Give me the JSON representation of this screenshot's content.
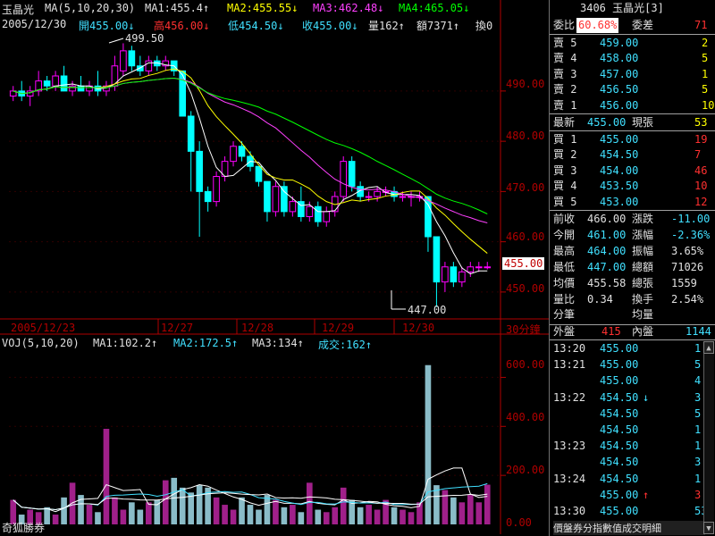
{
  "header": {
    "stock_name": "玉晶光",
    "ma_label": "MA(5,10,20,30)",
    "ma1": "MA1:455.4↑",
    "ma2": "MA2:455.55↓",
    "ma3": "MA3:462.48↓",
    "ma4": "MA4:465.05↓",
    "date": "2005/12/30",
    "open": "開455.00↓",
    "high": "高456.00↓",
    "low": "低454.50↓",
    "close": "收455.00↓",
    "volume": "量162↑",
    "amount": "額7371↑",
    "turnover": "換0"
  },
  "price_chart": {
    "y_ticks": [
      "490.00",
      "480.00",
      "470.00",
      "460.00",
      "450.00"
    ],
    "current_price_tag": "455.00",
    "max_label": "499.50",
    "min_label": "447.00",
    "x_labels": [
      "2005/12/23",
      "12/27",
      "12/28",
      "12/29",
      "12/30"
    ],
    "period": "30分鐘"
  },
  "volume_chart": {
    "label": "VOJ(5,10,20)",
    "ma1": "MA1:102.2↑",
    "ma2": "MA2:172.5↑",
    "ma3": "MA3:134↑",
    "deal": "成交:162↑",
    "y_ticks": [
      "600.00",
      "400.00",
      "200.00",
      "0.00"
    ],
    "brand": "奇狐勝券"
  },
  "colors": {
    "up": "#ff00ff",
    "down": "#00ffff",
    "ma1": "#ffffff",
    "ma2": "#ffff00",
    "ma3": "#ff40ff",
    "ma4": "#00ff00",
    "axis": "#b00000"
  },
  "chart_data": {
    "type": "candlestick",
    "x": "30-minute bars 2005/12/23 – 2005/12/30",
    "y_range": [
      445,
      501
    ],
    "bars": [
      [
        489,
        491,
        488,
        490
      ],
      [
        490,
        492,
        488,
        489
      ],
      [
        489,
        491,
        487,
        490
      ],
      [
        490,
        494,
        489,
        492
      ],
      [
        492,
        493,
        490,
        491
      ],
      [
        491,
        494,
        490,
        493
      ],
      [
        493,
        495,
        490,
        490
      ],
      [
        490,
        492,
        489,
        491
      ],
      [
        491,
        493,
        490,
        490
      ],
      [
        490,
        492,
        489,
        491
      ],
      [
        491,
        494,
        489,
        490
      ],
      [
        490,
        492,
        489,
        491
      ],
      [
        491,
        497,
        490,
        495
      ],
      [
        494,
        499.5,
        493,
        498
      ],
      [
        498,
        499,
        494,
        495
      ],
      [
        495,
        497,
        493,
        494
      ],
      [
        494,
        497,
        493,
        496
      ],
      [
        496,
        497,
        494,
        495
      ],
      [
        495,
        497,
        494,
        496
      ],
      [
        496,
        496,
        493,
        494
      ],
      [
        494,
        494,
        485,
        485
      ],
      [
        485,
        486,
        470,
        478
      ],
      [
        478,
        480,
        461,
        470
      ],
      [
        470,
        471,
        466,
        468
      ],
      [
        468,
        474,
        467,
        473
      ],
      [
        473,
        477,
        472,
        476
      ],
      [
        476,
        480,
        475,
        479
      ],
      [
        479,
        480,
        476,
        477
      ],
      [
        477,
        478,
        474,
        475
      ],
      [
        475,
        475,
        471,
        472
      ],
      [
        472,
        472,
        464,
        466
      ],
      [
        466,
        472,
        465,
        471
      ],
      [
        471,
        472,
        465,
        466
      ],
      [
        466,
        469,
        465,
        468
      ],
      [
        468,
        471,
        464,
        465
      ],
      [
        465,
        468,
        464,
        467
      ],
      [
        467,
        468,
        463,
        464
      ],
      [
        464,
        467,
        463,
        466
      ],
      [
        466,
        470,
        465,
        469
      ],
      [
        469,
        477,
        468,
        476
      ],
      [
        476,
        477,
        470,
        471
      ],
      [
        471,
        472,
        468,
        469
      ],
      [
        469,
        470,
        468,
        469
      ],
      [
        469,
        471,
        468,
        470
      ],
      [
        470,
        471,
        469,
        470
      ],
      [
        470,
        471,
        468,
        469
      ],
      [
        469,
        470,
        468,
        469
      ],
      [
        469,
        470,
        467,
        469
      ],
      [
        469,
        470,
        468,
        469
      ],
      [
        469,
        469,
        458,
        461
      ],
      [
        461,
        461,
        447,
        452
      ],
      [
        452,
        456,
        450,
        455
      ],
      [
        455,
        456,
        451,
        452
      ],
      [
        452,
        455,
        451,
        454
      ],
      [
        454,
        456,
        453,
        455
      ],
      [
        455,
        456,
        454,
        455
      ],
      [
        455,
        456,
        454.5,
        455
      ]
    ],
    "volume": [
      100,
      40,
      60,
      50,
      70,
      40,
      110,
      170,
      120,
      80,
      50,
      390,
      110,
      60,
      90,
      60,
      90,
      100,
      180,
      190,
      150,
      130,
      160,
      150,
      110,
      80,
      60,
      110,
      80,
      60,
      120,
      100,
      70,
      80,
      50,
      170,
      60,
      50,
      70,
      150,
      100,
      70,
      80,
      60,
      100,
      70,
      60,
      50,
      90,
      650,
      160,
      140,
      110,
      90,
      120,
      90,
      162
    ]
  },
  "panel": {
    "title": "3406 玉晶光[3]",
    "bid_ratio_label": "委比",
    "bid_ratio": "60.68%",
    "bid_diff_label": "委差",
    "bid_diff": "71",
    "asks": [
      {
        "label": "賣 5",
        "price": "459.00",
        "vol": "2"
      },
      {
        "label": "賣 4",
        "price": "458.00",
        "vol": "5"
      },
      {
        "label": "賣 3",
        "price": "457.00",
        "vol": "1"
      },
      {
        "label": "賣 2",
        "price": "456.50",
        "vol": "5"
      },
      {
        "label": "賣 1",
        "price": "456.00",
        "vol": "10"
      }
    ],
    "latest_label": "最新",
    "latest": "455.00",
    "cur_vol_label": "現張",
    "cur_vol": "53",
    "bids": [
      {
        "label": "買 1",
        "price": "455.00",
        "vol": "19"
      },
      {
        "label": "買 2",
        "price": "454.50",
        "vol": "7"
      },
      {
        "label": "買 3",
        "price": "454.00",
        "vol": "46"
      },
      {
        "label": "買 4",
        "price": "453.50",
        "vol": "10"
      },
      {
        "label": "買 5",
        "price": "453.00",
        "vol": "12"
      }
    ],
    "stats": [
      {
        "l1": "前收",
        "v1": "466.00",
        "l2": "漲跌",
        "v2": "-11.00"
      },
      {
        "l1": "今開",
        "v1": "461.00",
        "l2": "漲幅",
        "v2": "-2.36%"
      },
      {
        "l1": "最高",
        "v1": "464.00",
        "l2": "振幅",
        "v2": "3.65%"
      },
      {
        "l1": "最低",
        "v1": "447.00",
        "l2": "總額",
        "v2": "71026"
      },
      {
        "l1": "均價",
        "v1": "455.58",
        "l2": "總張",
        "v2": "1559"
      },
      {
        "l1": "量比",
        "v1": "0.34",
        "l2": "換手",
        "v2": "2.54%"
      },
      {
        "l1": "分筆",
        "v1": "",
        "l2": "均量",
        "v2": ""
      }
    ],
    "outer_label": "外盤",
    "outer": "415",
    "inner_label": "內盤",
    "inner": "1144",
    "ticks": [
      {
        "time": "13:20",
        "price": "455.00",
        "arrow": "",
        "vol": "1"
      },
      {
        "time": "13:21",
        "price": "455.00",
        "arrow": "",
        "vol": "5"
      },
      {
        "time": "",
        "price": "455.00",
        "arrow": "",
        "vol": "4"
      },
      {
        "time": "13:22",
        "price": "454.50",
        "arrow": "↓",
        "vol": "3"
      },
      {
        "time": "",
        "price": "454.50",
        "arrow": "",
        "vol": "5"
      },
      {
        "time": "",
        "price": "454.50",
        "arrow": "",
        "vol": "1"
      },
      {
        "time": "13:23",
        "price": "454.50",
        "arrow": "",
        "vol": "1"
      },
      {
        "time": "",
        "price": "454.50",
        "arrow": "",
        "vol": "3"
      },
      {
        "time": "13:24",
        "price": "454.50",
        "arrow": "",
        "vol": "1"
      },
      {
        "time": "",
        "price": "455.00",
        "arrow": "↑",
        "vol": "3"
      },
      {
        "time": "13:30",
        "price": "455.00",
        "arrow": "",
        "vol": "53"
      }
    ],
    "footer": "價盤券分指數值成交明細"
  }
}
